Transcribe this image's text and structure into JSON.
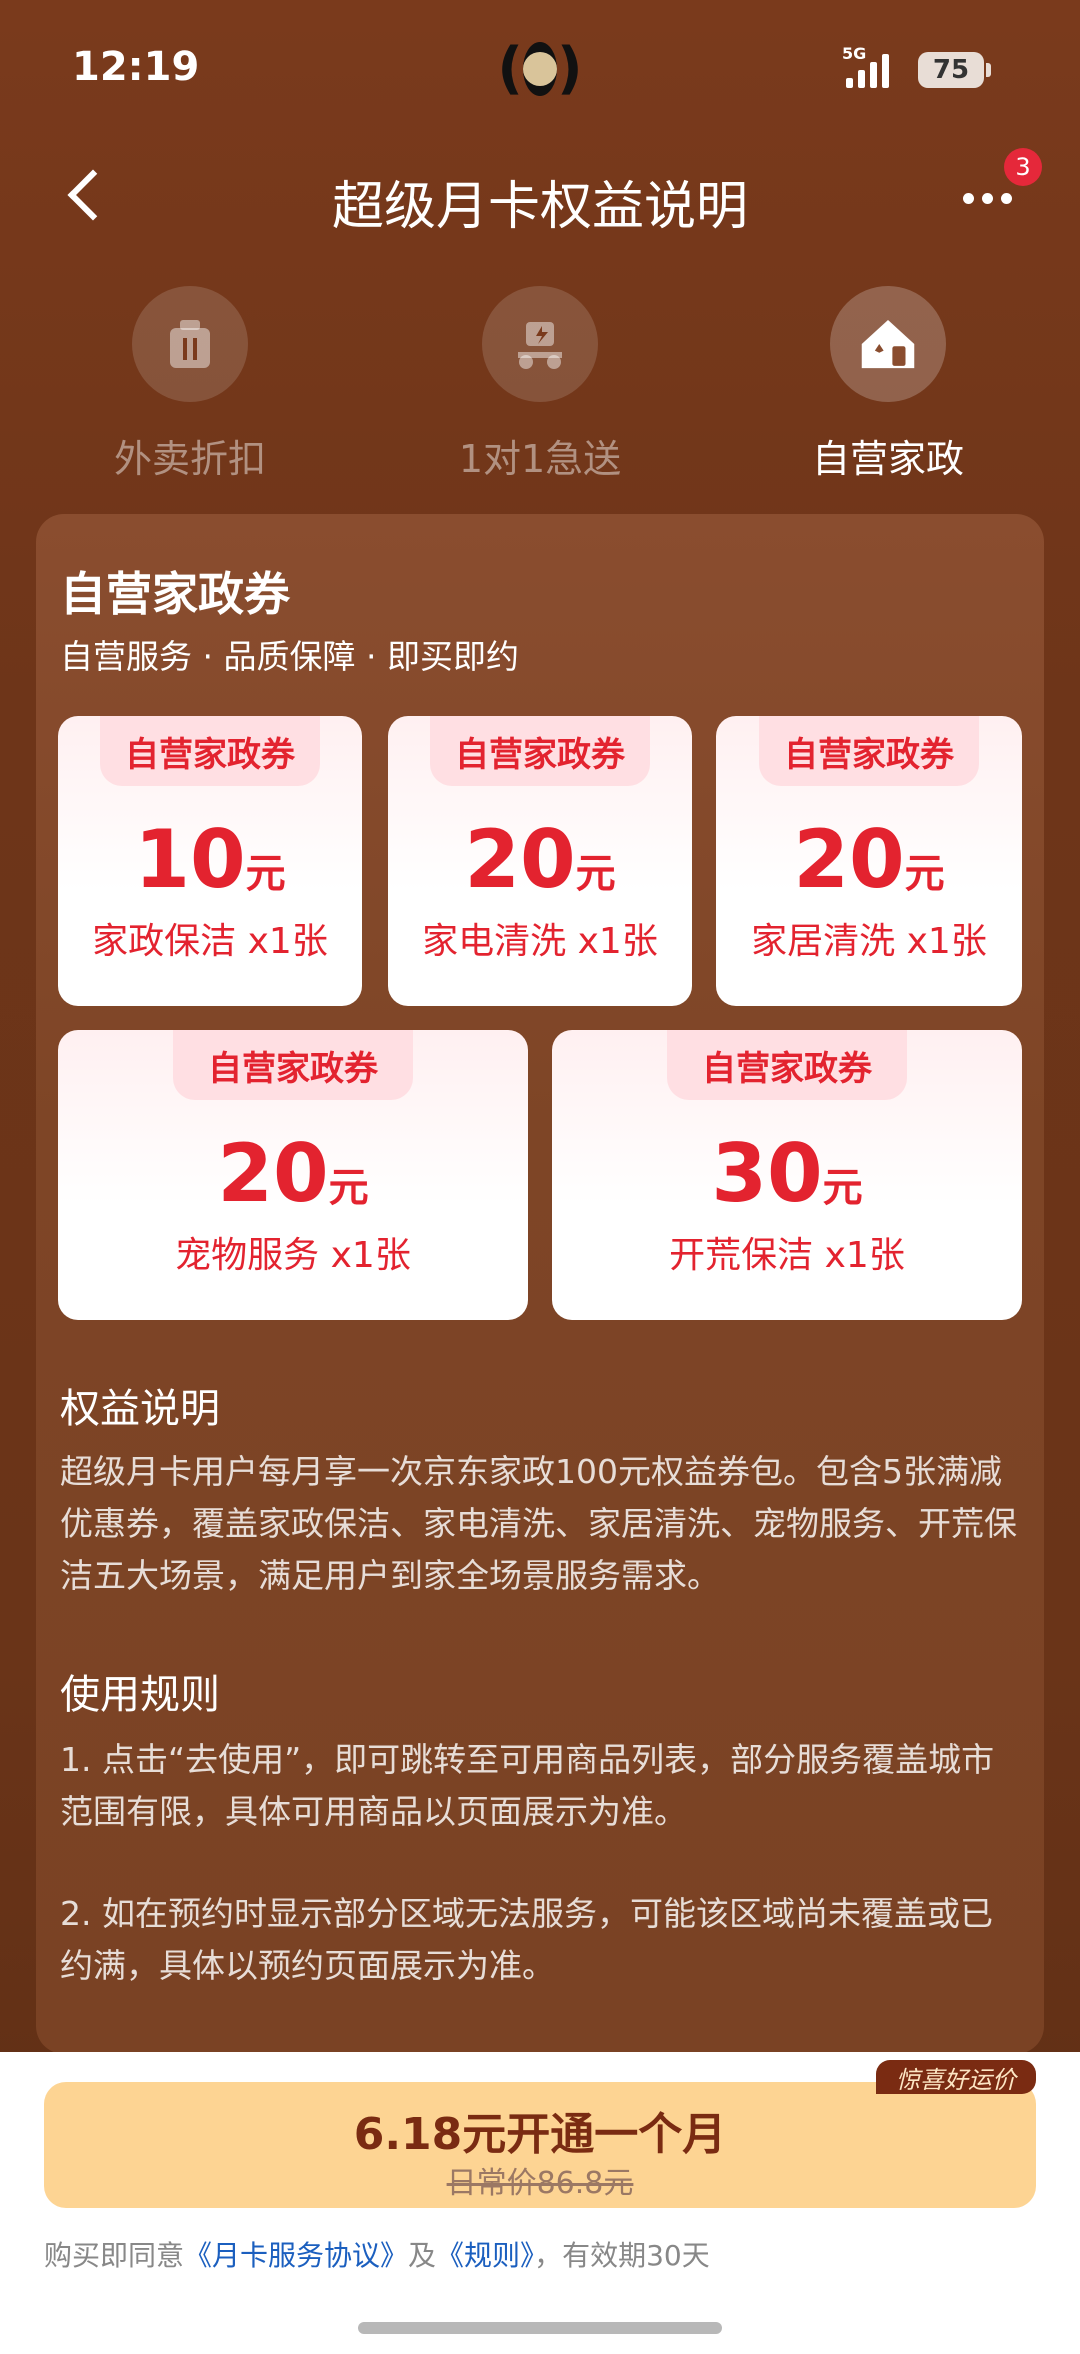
{
  "status_bar": {
    "time": "12:19",
    "network": "5G",
    "battery": "75"
  },
  "header": {
    "title": "超级月卡权益说明",
    "notification_count": "3"
  },
  "tabs": [
    {
      "label": "外卖折扣",
      "icon": "takeout-icon",
      "active": false
    },
    {
      "label": "1对1急送",
      "icon": "delivery-scooter-icon",
      "active": false
    },
    {
      "label": "自营家政",
      "icon": "home-cleaning-icon",
      "active": true
    }
  ],
  "card": {
    "title": "自营家政券",
    "subtitle": "自营服务 · 品质保障 · 即买即约",
    "coupons": [
      {
        "tag": "自营家政券",
        "amount": "10",
        "unit": "元",
        "desc": "家政保洁 x1张"
      },
      {
        "tag": "自营家政券",
        "amount": "20",
        "unit": "元",
        "desc": "家电清洗 x1张"
      },
      {
        "tag": "自营家政券",
        "amount": "20",
        "unit": "元",
        "desc": "家居清洗 x1张"
      },
      {
        "tag": "自营家政券",
        "amount": "20",
        "unit": "元",
        "desc": "宠物服务 x1张"
      },
      {
        "tag": "自营家政券",
        "amount": "30",
        "unit": "元",
        "desc": "开荒保洁 x1张"
      }
    ],
    "benefit_title": "权益说明",
    "benefit_text": "超级月卡用户每月享一次京东家政100元权益券包。包含5张满减优惠券，覆盖家政保洁、家电清洗、家居清洗、宠物服务、开荒保洁五大场景，满足用户到家全场景服务需求。",
    "rules_title": "使用规则",
    "rules": [
      "1. 点击“去使用”，即可跳转至可用商品列表，部分服务覆盖城市范围有限，具体可用商品以页面展示为准。",
      "2. 如在预约时显示部分区域无法服务，可能该区域尚未覆盖或已约满，具体以预约页面展示为准。"
    ]
  },
  "purchase": {
    "cta_label": "6.18元开通一个月",
    "original_price": "日常价86.8元",
    "promo_tag": "惊喜好运价",
    "agree_prefix": "购买即同意",
    "agreement_link": "《月卡服务协议》",
    "agree_and": "及",
    "rules_link": "《规则》",
    "agree_suffix": "，有效期30天"
  },
  "colors": {
    "background": "#6e3519",
    "coupon_red": "#e3232f",
    "cta": "#fdd493",
    "link": "#1b5fbf"
  }
}
